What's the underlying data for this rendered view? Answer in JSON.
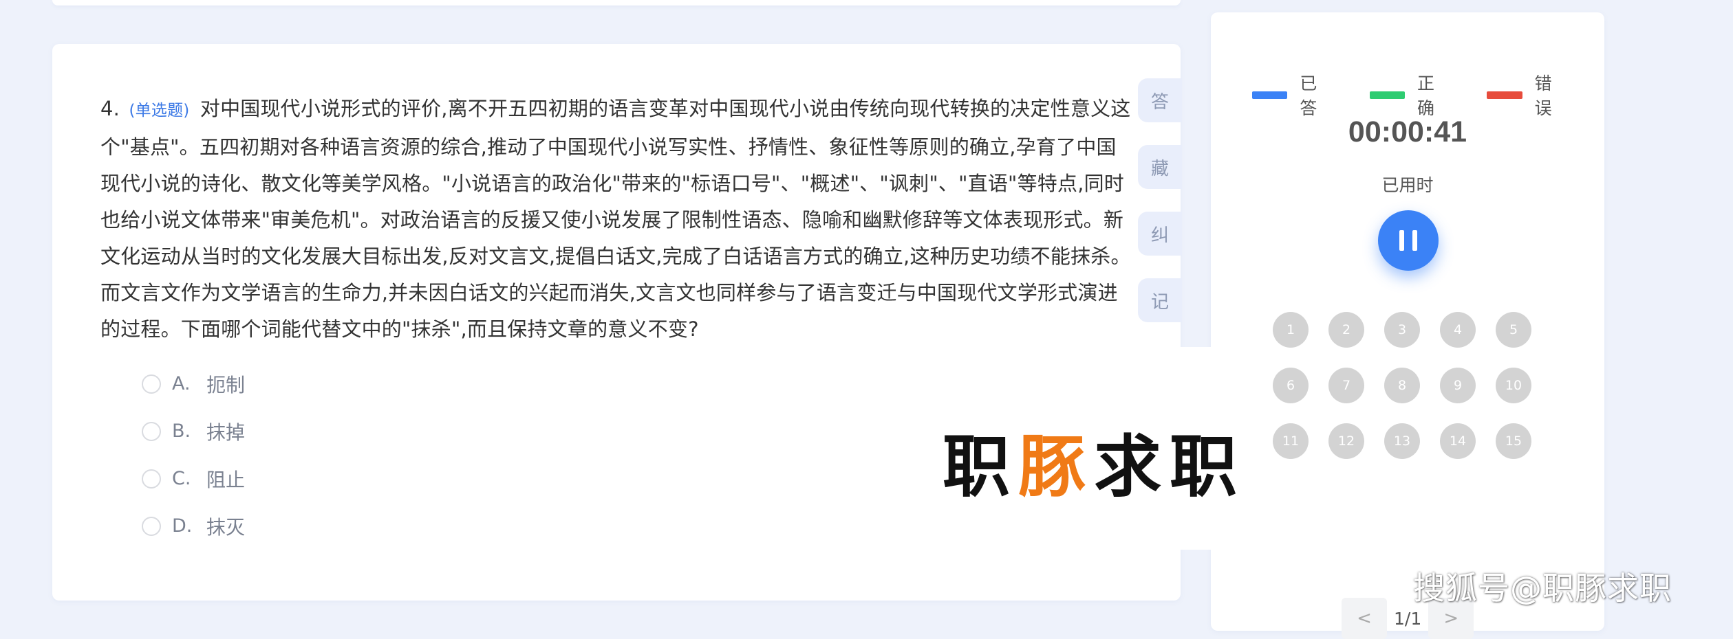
{
  "question": {
    "number": "4.",
    "type_label": "(单选题)",
    "text": "对中国现代小说形式的评价,离不开五四初期的语言变革对中国现代小说由传统向现代转换的决定性意义这个\"基点\"。五四初期对各种语言资源的综合,推动了中国现代小说写实性、抒情性、象征性等原则的确立,孕育了中国现代小说的诗化、散文化等美学风格。\"小说语言的政治化\"带来的\"标语口号\"、\"概述\"、\"讽刺\"、\"直语\"等特点,同时也给小说文体带来\"审美危机\"。对政治语言的反援又使小说发展了限制性语态、隐喻和幽默修辞等文体表现形式。新文化运动从当时的文化发展大目标出发,反对文言文,提倡白话文,完成了白话语言方式的确立,这种历史功绩不能抹杀。而文言文作为文学语言的生命力,并未因白话文的兴起而消失,文言文也同样参与了语言变迁与中国现代文学形式演进的过程。下面哪个词能代替文中的\"抹杀\",而且保持文章的意义不变?",
    "options": [
      {
        "letter": "A.",
        "text": "扼制"
      },
      {
        "letter": "B.",
        "text": "抹掉"
      },
      {
        "letter": "C.",
        "text": "阻止"
      },
      {
        "letter": "D.",
        "text": "抹灭"
      }
    ]
  },
  "side_tabs": [
    "答",
    "藏",
    "纠",
    "记"
  ],
  "panel": {
    "legend": [
      {
        "label": "已答",
        "color": "#3b82f6"
      },
      {
        "label": "正确",
        "color": "#2ecc71"
      },
      {
        "label": "错误",
        "color": "#e74c3c"
      }
    ],
    "timer": "00:00:41",
    "elapsed_label": "已用时",
    "question_numbers": [
      "1",
      "2",
      "3",
      "4",
      "5",
      "6",
      "7",
      "8",
      "9",
      "10",
      "11",
      "12",
      "13",
      "14",
      "15"
    ],
    "pager": {
      "prev": "<",
      "text": "1/1",
      "next": ">"
    }
  },
  "watermark": {
    "part1": "职",
    "part2": "豚",
    "part3": "求职",
    "corner": "搜狐号@职豚求职"
  }
}
